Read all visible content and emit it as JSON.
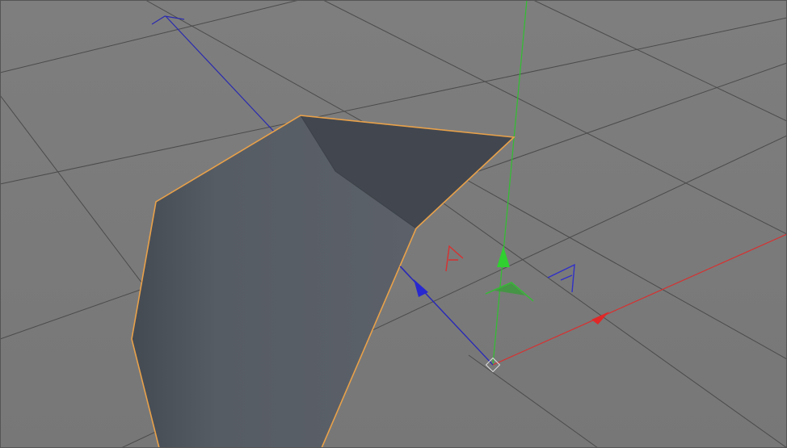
{
  "viewport": {
    "background": "#7d7d7d",
    "grid_color": "#4a4a4a"
  },
  "object": {
    "selection_outline_color": "#e8a14a",
    "face_front_color": "#5a6068",
    "face_inner_color": "#434850"
  },
  "gizmo": {
    "x_axis_color": "#e03030",
    "y_axis_color": "#33cc33",
    "z_axis_color": "#3333cc",
    "origin_icon": "origin-diamond-icon"
  }
}
